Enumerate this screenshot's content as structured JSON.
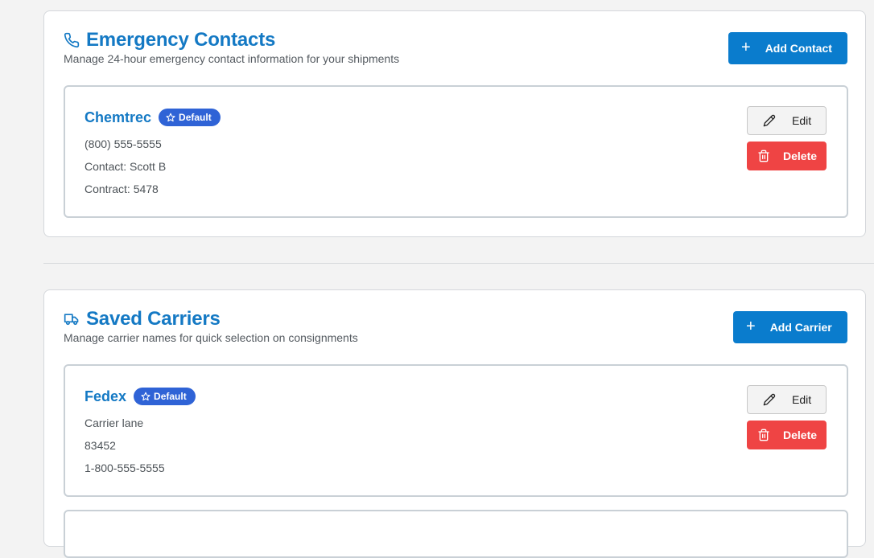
{
  "emergency_contacts": {
    "title": "Emergency Contacts",
    "subtitle": "Manage 24-hour emergency contact information for your shipments",
    "add_label": "Add Contact",
    "items": [
      {
        "name": "Chemtrec",
        "badge": "Default",
        "lines": [
          "(800) 555-5555",
          "Contact: Scott B",
          "Contract: 5478"
        ],
        "edit_label": "Edit",
        "delete_label": "Delete"
      }
    ]
  },
  "saved_carriers": {
    "title": "Saved Carriers",
    "subtitle": "Manage carrier names for quick selection on consignments",
    "add_label": "Add Carrier",
    "items": [
      {
        "name": "Fedex",
        "badge": "Default",
        "lines": [
          "Carrier lane",
          "83452",
          "1-800-555-5555"
        ],
        "edit_label": "Edit",
        "delete_label": "Delete"
      }
    ]
  },
  "icons": {
    "contacts": "phone-icon",
    "carriers": "truck-icon",
    "add": "plus-icon",
    "badge": "star-icon",
    "edit": "pencil-icon",
    "delete": "trash-icon"
  },
  "colors": {
    "accent": "#1479c4",
    "primary_button": "#0a7ccd",
    "badge": "#2f63d6",
    "danger": "#ef4444"
  }
}
